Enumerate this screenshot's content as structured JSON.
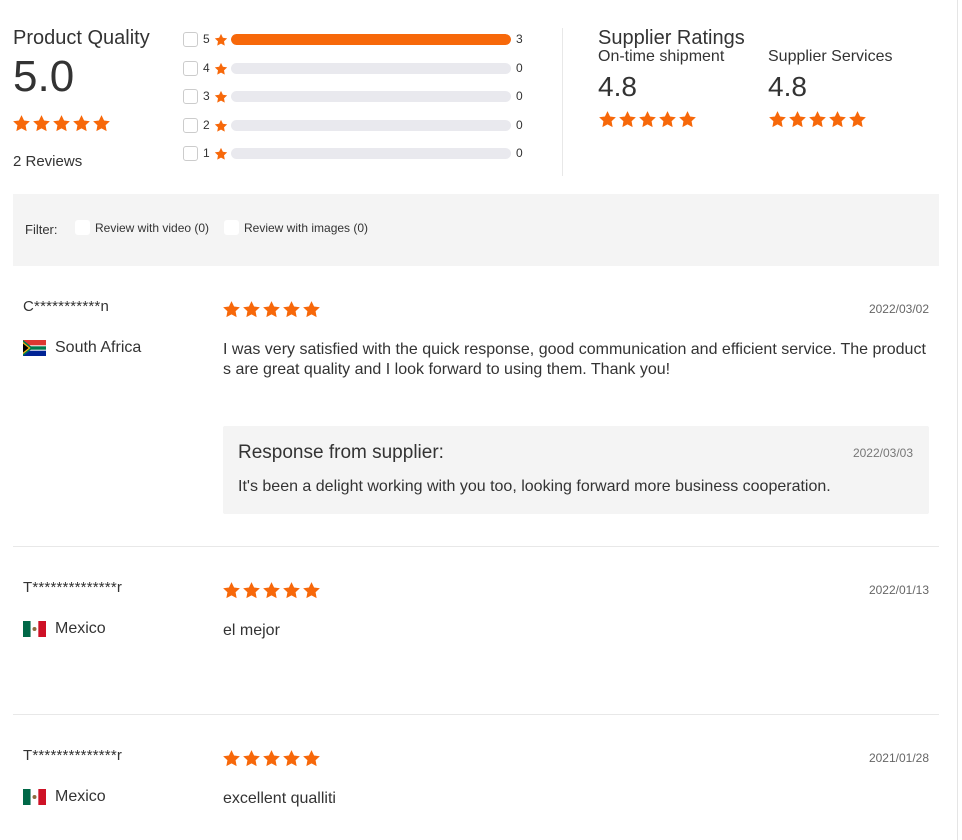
{
  "colors": {
    "accent": "#f7680a",
    "track": "#e9e9ee",
    "panel": "#f4f4f4"
  },
  "product_quality": {
    "title": "Product Quality",
    "score": "5.0",
    "rating": 5,
    "reviews": "2 Reviews"
  },
  "distribution": [
    {
      "stars": "5",
      "count": "3",
      "fraction": 1.0
    },
    {
      "stars": "4",
      "count": "0",
      "fraction": 0
    },
    {
      "stars": "3",
      "count": "0",
      "fraction": 0
    },
    {
      "stars": "2",
      "count": "0",
      "fraction": 0
    },
    {
      "stars": "1",
      "count": "0",
      "fraction": 0
    }
  ],
  "supplier_ratings": {
    "title": "Supplier Ratings",
    "ontime": {
      "label": "On-time shipment",
      "score": "4.8",
      "rating": 5
    },
    "services": {
      "label": "Supplier Services",
      "score": "4.8",
      "rating": 5
    }
  },
  "filter": {
    "label": "Filter:",
    "video": "Review with video (0)",
    "images": "Review with images (0)"
  },
  "reviews": [
    {
      "name": "C***********n",
      "country": "South Africa",
      "flag": "south-africa-flag-icon",
      "date": "2022/03/02",
      "rating": 5,
      "text": "I was very satisfied with the quick response, good communication and efficient service. The products are great quality and I look forward to using them. Thank you!",
      "response": {
        "title": "Response from supplier:",
        "date": "2022/03/03",
        "text": "It's been a delight working with you too, looking forward more business cooperation."
      }
    },
    {
      "name": "T**************r",
      "country": "Mexico",
      "flag": "mexico-flag-icon",
      "date": "2022/01/13",
      "rating": 5,
      "text": "el mejor"
    },
    {
      "name": "T**************r",
      "country": "Mexico",
      "flag": "mexico-flag-icon",
      "date": "2021/01/28",
      "rating": 5,
      "text": "excellent qualliti"
    }
  ]
}
